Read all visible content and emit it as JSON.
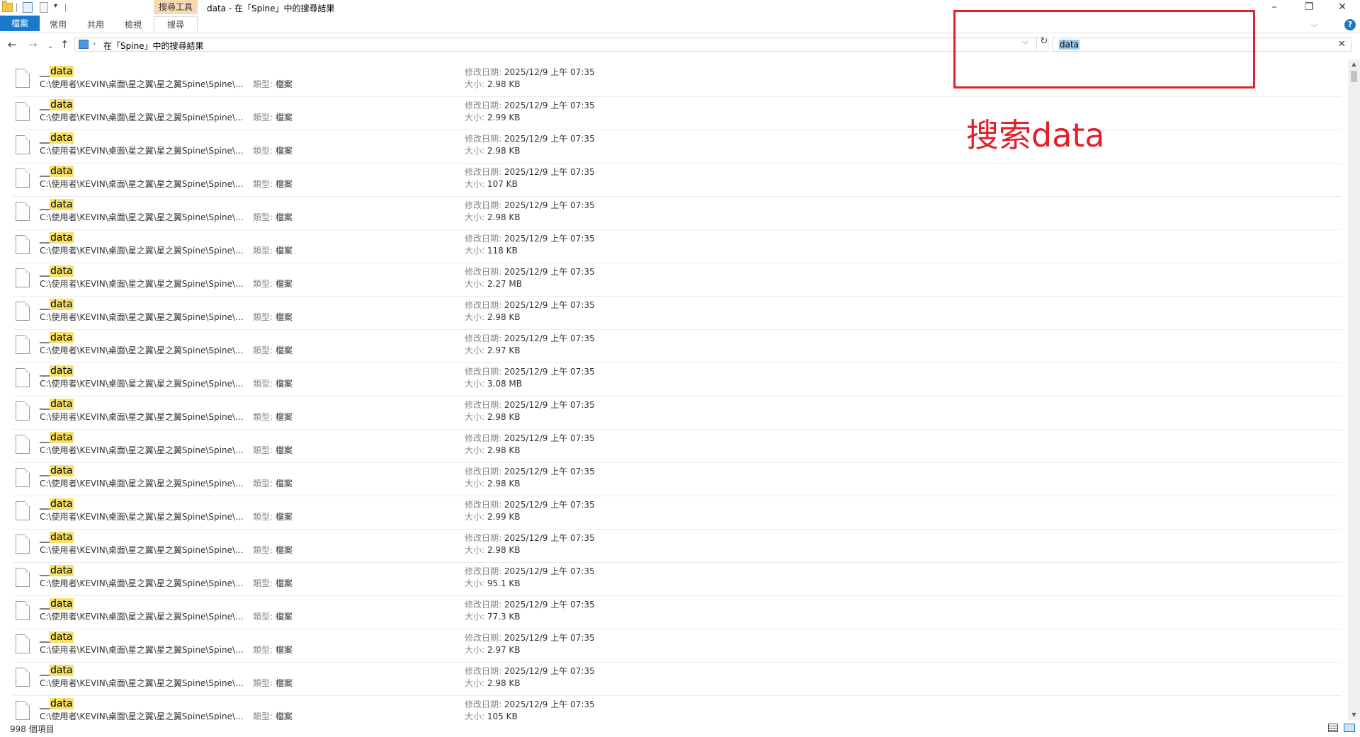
{
  "titlebar": {
    "context_tab": "搜尋工具",
    "title": "data - 在「Spine」中的搜尋結果",
    "minimize": "–",
    "maximize": "❐",
    "close": "✕"
  },
  "ribbon": {
    "tabs": [
      {
        "label": "檔案"
      },
      {
        "label": "常用"
      },
      {
        "label": "共用"
      },
      {
        "label": "檢視"
      },
      {
        "label": "搜尋"
      }
    ],
    "collapse_glyph": "⌵",
    "help_glyph": "?"
  },
  "nav": {
    "back": "←",
    "forward": "→",
    "recent": "⌄",
    "up": "↑",
    "address_sep": "›",
    "address": "在「Spine」中的搜尋結果",
    "address_drop": "⌵",
    "refresh": "↻"
  },
  "search": {
    "value": "data",
    "clear": "✕"
  },
  "labels": {
    "type": "類型:",
    "modified": "修改日期:",
    "size": "大小:"
  },
  "items": [
    {
      "prefix": "__",
      "match": "data",
      "path": "C:\\使用者\\KEVIN\\桌面\\星之翼\\星之翼Spine\\Spine\\...",
      "type": "檔案",
      "modified": "2025/12/9 上午 07:35",
      "size": "2.98 KB"
    },
    {
      "prefix": "__",
      "match": "data",
      "path": "C:\\使用者\\KEVIN\\桌面\\星之翼\\星之翼Spine\\Spine\\...",
      "type": "檔案",
      "modified": "2025/12/9 上午 07:35",
      "size": "2.99 KB"
    },
    {
      "prefix": "__",
      "match": "data",
      "path": "C:\\使用者\\KEVIN\\桌面\\星之翼\\星之翼Spine\\Spine\\...",
      "type": "檔案",
      "modified": "2025/12/9 上午 07:35",
      "size": "2.98 KB"
    },
    {
      "prefix": "__",
      "match": "data",
      "path": "C:\\使用者\\KEVIN\\桌面\\星之翼\\星之翼Spine\\Spine\\...",
      "type": "檔案",
      "modified": "2025/12/9 上午 07:35",
      "size": "107 KB"
    },
    {
      "prefix": "__",
      "match": "data",
      "path": "C:\\使用者\\KEVIN\\桌面\\星之翼\\星之翼Spine\\Spine\\...",
      "type": "檔案",
      "modified": "2025/12/9 上午 07:35",
      "size": "2.98 KB"
    },
    {
      "prefix": "__",
      "match": "data",
      "path": "C:\\使用者\\KEVIN\\桌面\\星之翼\\星之翼Spine\\Spine\\...",
      "type": "檔案",
      "modified": "2025/12/9 上午 07:35",
      "size": "118 KB"
    },
    {
      "prefix": "__",
      "match": "data",
      "path": "C:\\使用者\\KEVIN\\桌面\\星之翼\\星之翼Spine\\Spine\\...",
      "type": "檔案",
      "modified": "2025/12/9 上午 07:35",
      "size": "2.27 MB"
    },
    {
      "prefix": "__",
      "match": "data",
      "path": "C:\\使用者\\KEVIN\\桌面\\星之翼\\星之翼Spine\\Spine\\...",
      "type": "檔案",
      "modified": "2025/12/9 上午 07:35",
      "size": "2.98 KB"
    },
    {
      "prefix": "__",
      "match": "data",
      "path": "C:\\使用者\\KEVIN\\桌面\\星之翼\\星之翼Spine\\Spine\\...",
      "type": "檔案",
      "modified": "2025/12/9 上午 07:35",
      "size": "2.97 KB"
    },
    {
      "prefix": "__",
      "match": "data",
      "path": "C:\\使用者\\KEVIN\\桌面\\星之翼\\星之翼Spine\\Spine\\...",
      "type": "檔案",
      "modified": "2025/12/9 上午 07:35",
      "size": "3.08 MB"
    },
    {
      "prefix": "__",
      "match": "data",
      "path": "C:\\使用者\\KEVIN\\桌面\\星之翼\\星之翼Spine\\Spine\\...",
      "type": "檔案",
      "modified": "2025/12/9 上午 07:35",
      "size": "2.98 KB"
    },
    {
      "prefix": "__",
      "match": "data",
      "path": "C:\\使用者\\KEVIN\\桌面\\星之翼\\星之翼Spine\\Spine\\...",
      "type": "檔案",
      "modified": "2025/12/9 上午 07:35",
      "size": "2.98 KB"
    },
    {
      "prefix": "__",
      "match": "data",
      "path": "C:\\使用者\\KEVIN\\桌面\\星之翼\\星之翼Spine\\Spine\\...",
      "type": "檔案",
      "modified": "2025/12/9 上午 07:35",
      "size": "2.98 KB"
    },
    {
      "prefix": "__",
      "match": "data",
      "path": "C:\\使用者\\KEVIN\\桌面\\星之翼\\星之翼Spine\\Spine\\...",
      "type": "檔案",
      "modified": "2025/12/9 上午 07:35",
      "size": "2.99 KB"
    },
    {
      "prefix": "__",
      "match": "data",
      "path": "C:\\使用者\\KEVIN\\桌面\\星之翼\\星之翼Spine\\Spine\\...",
      "type": "檔案",
      "modified": "2025/12/9 上午 07:35",
      "size": "2.98 KB"
    },
    {
      "prefix": "__",
      "match": "data",
      "path": "C:\\使用者\\KEVIN\\桌面\\星之翼\\星之翼Spine\\Spine\\...",
      "type": "檔案",
      "modified": "2025/12/9 上午 07:35",
      "size": "95.1 KB"
    },
    {
      "prefix": "__",
      "match": "data",
      "path": "C:\\使用者\\KEVIN\\桌面\\星之翼\\星之翼Spine\\Spine\\...",
      "type": "檔案",
      "modified": "2025/12/9 上午 07:35",
      "size": "77.3 KB"
    },
    {
      "prefix": "__",
      "match": "data",
      "path": "C:\\使用者\\KEVIN\\桌面\\星之翼\\星之翼Spine\\Spine\\...",
      "type": "檔案",
      "modified": "2025/12/9 上午 07:35",
      "size": "2.97 KB"
    },
    {
      "prefix": "__",
      "match": "data",
      "path": "C:\\使用者\\KEVIN\\桌面\\星之翼\\星之翼Spine\\Spine\\...",
      "type": "檔案",
      "modified": "2025/12/9 上午 07:35",
      "size": "2.98 KB"
    },
    {
      "prefix": "__",
      "match": "data",
      "path": "C:\\使用者\\KEVIN\\桌面\\星之翼\\星之翼Spine\\Spine\\...",
      "type": "檔案",
      "modified": "2025/12/9 上午 07:35",
      "size": "105 KB"
    }
  ],
  "status": {
    "count": "998 個項目"
  },
  "annotation": {
    "text": "搜索data",
    "color": "#e0202a"
  },
  "colors": {
    "accent": "#1979ca",
    "highlight": "#f7e16b",
    "context_tab": "#f8d8b4"
  }
}
